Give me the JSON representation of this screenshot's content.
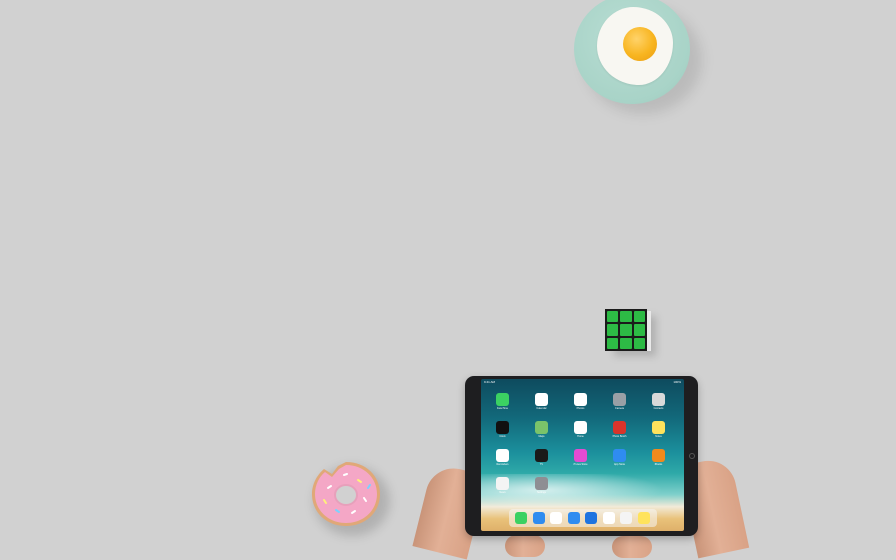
{
  "scene": {
    "description_objects": [
      "fried-egg-plate",
      "rubiks-cube",
      "frosted-donut",
      "ipad",
      "hands"
    ],
    "colors": {
      "background": "#d1d1d1",
      "plate": "#a8d3c7",
      "yolk": "#f8b520",
      "cube_face": "#2dbb45",
      "donut_frosting": "#f4a7c6",
      "ipad_bezel": "#1e1e20"
    }
  },
  "ipad": {
    "status_time": "9:41 AM",
    "status_battery": "100%",
    "apps": [
      {
        "icon": "facetime-icon",
        "color": "#3bd162",
        "label": "FaceTime"
      },
      {
        "icon": "calendar-icon",
        "color": "#ffffff",
        "label": "Calendar"
      },
      {
        "icon": "photos-icon",
        "color": "#ffffff",
        "label": "Photos"
      },
      {
        "icon": "camera-icon",
        "color": "#9aa0a6",
        "label": "Camera"
      },
      {
        "icon": "contacts-icon",
        "color": "#d9d9d9",
        "label": "Contacts"
      },
      {
        "icon": "clock-icon",
        "color": "#111111",
        "label": "Clock"
      },
      {
        "icon": "maps-icon",
        "color": "#7ac36a",
        "label": "Maps"
      },
      {
        "icon": "home-icon",
        "color": "#ffffff",
        "label": "Home"
      },
      {
        "icon": "photo-booth-icon",
        "color": "#d9342b",
        "label": "Photo Booth"
      },
      {
        "icon": "notes-icon",
        "color": "#ffe35c",
        "label": "Notes"
      },
      {
        "icon": "reminders-icon",
        "color": "#ffffff",
        "label": "Reminders"
      },
      {
        "icon": "tv-icon",
        "color": "#1a1a1a",
        "label": "TV"
      },
      {
        "icon": "itunes-store-icon",
        "color": "#e34bd2",
        "label": "iTunes Store"
      },
      {
        "icon": "app-store-icon",
        "color": "#2f8cf0",
        "label": "App Store"
      },
      {
        "icon": "ibooks-icon",
        "color": "#f08a1c",
        "label": "iBooks"
      },
      {
        "icon": "news-icon",
        "color": "#f4f4f4",
        "label": "News"
      },
      {
        "icon": "settings-icon",
        "color": "#8e8e93",
        "label": "Settings"
      }
    ],
    "dock": [
      {
        "icon": "messages-icon",
        "color": "#3bd162"
      },
      {
        "icon": "safari-icon",
        "color": "#2f8cf0"
      },
      {
        "icon": "music-icon",
        "color": "#ffffff"
      },
      {
        "icon": "mail-icon",
        "color": "#2f8cf0"
      },
      {
        "icon": "files-icon",
        "color": "#1e74e0"
      },
      {
        "icon": "photos-icon",
        "color": "#ffffff"
      },
      {
        "icon": "news-icon",
        "color": "#f4f4f4"
      },
      {
        "icon": "notes-icon",
        "color": "#ffe35c"
      }
    ]
  }
}
